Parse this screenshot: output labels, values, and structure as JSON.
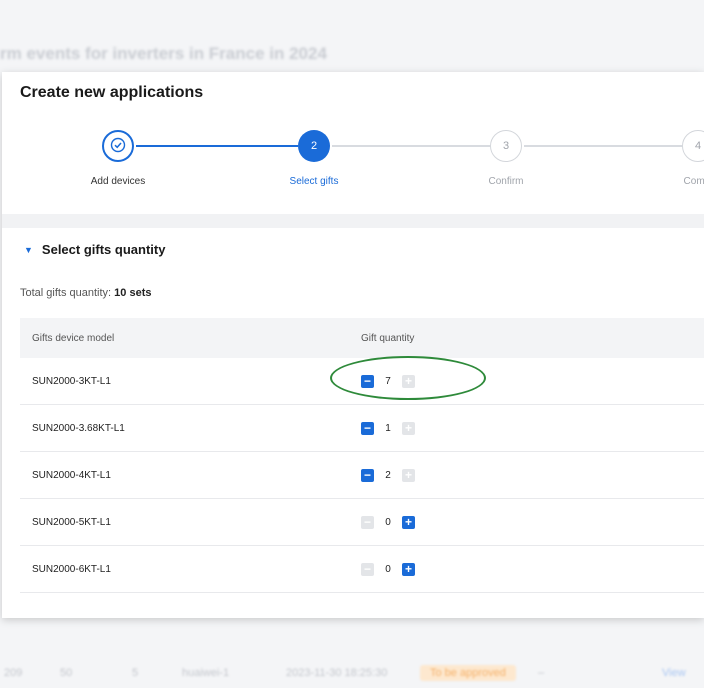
{
  "background": {
    "title": "rm events for inverters in France in 2024",
    "row": {
      "c1": "209",
      "c2": "50",
      "c3": "5",
      "c4": "huaiwei-1",
      "c5": "2023-11-30 18:25:30",
      "status": "To be approved",
      "c7": "–",
      "view": "View"
    }
  },
  "dialog": {
    "title": "Create new applications",
    "steps": [
      {
        "number": "",
        "label": "Add devices",
        "state": "done"
      },
      {
        "number": "2",
        "label": "Select gifts",
        "state": "active"
      },
      {
        "number": "3",
        "label": "Confirm",
        "state": "pending"
      },
      {
        "number": "4",
        "label": "Compl",
        "state": "pending"
      }
    ],
    "section_title": "Select gifts quantity",
    "total_label": "Total gifts quantity:",
    "total_value": "10 sets",
    "table": {
      "headers": [
        "Gifts device model",
        "Gift quantity"
      ],
      "rows": [
        {
          "model": "SUN2000-3KT-L1",
          "quantity": "7"
        },
        {
          "model": "SUN2000-3.68KT-L1",
          "quantity": "1"
        },
        {
          "model": "SUN2000-4KT-L1",
          "quantity": "2"
        },
        {
          "model": "SUN2000-5KT-L1",
          "quantity": "0"
        },
        {
          "model": "SUN2000-6KT-L1",
          "quantity": "0"
        }
      ]
    }
  },
  "colors": {
    "accent": "#1a6bd8",
    "highlight": "#2e8a3a",
    "disabled": "#e3e5e8"
  },
  "icons": {
    "done_step": "checkmark-icon",
    "caret": "caret-down-icon",
    "minus": "minus-icon",
    "plus": "plus-icon"
  }
}
